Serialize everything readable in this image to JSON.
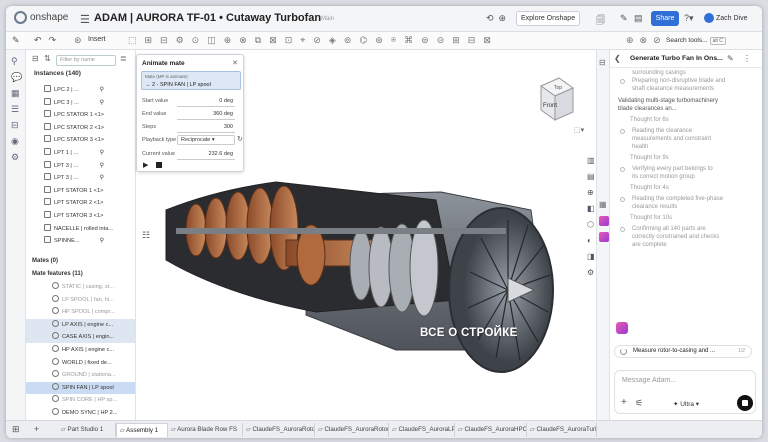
{
  "app": {
    "name": "onshape"
  },
  "document": {
    "title": "ADAM | AURORA TF-01 • Cutaway Turbofan",
    "branch": "Main"
  },
  "header": {
    "explore": "Explore Onshape",
    "share": "Share",
    "user": "Zach Dive"
  },
  "toolbar": {
    "insert": "Insert",
    "search": "Search tools...",
    "search_shortcut": "alt C"
  },
  "tree": {
    "filter_placeholder": "Filter by name",
    "instances_title": "Instances (140)",
    "instances": [
      {
        "label": "LPC 2 | ...",
        "mate": true
      },
      {
        "label": "LPC 3 | ...",
        "mate": true
      },
      {
        "label": "LPC STATOR 1 <1>"
      },
      {
        "label": "LPC STATOR 2 <1>"
      },
      {
        "label": "LPC STATOR 3 <1>"
      },
      {
        "label": "LPT 1 | ...",
        "mate": true
      },
      {
        "label": "LPT 3 | ...",
        "mate": true
      },
      {
        "label": "LPT 3 | ...",
        "mate": true
      },
      {
        "label": "LPT STATOR 1 <1>"
      },
      {
        "label": "LPT STATOR 2 <1>"
      },
      {
        "label": "LPT STATOR 3 <1>"
      },
      {
        "label": "NACELLE | rolled inta..."
      },
      {
        "label": "SPINNE...",
        "mate": true
      }
    ],
    "mates_title": "Mates (0)",
    "features_title": "Mate features (11)",
    "features": [
      {
        "label": "STATIC | casing, st...",
        "state": "grey"
      },
      {
        "label": "LP SPOOL | fan, hi...",
        "state": "grey"
      },
      {
        "label": "HP SPOOL | compr...",
        "state": "grey"
      },
      {
        "label": "LP AXIS | engine c...",
        "state": "sel"
      },
      {
        "label": "CASE AXIS | engin...",
        "state": "sel"
      },
      {
        "label": "HP AXIS | engine c...",
        "state": ""
      },
      {
        "label": "WORLD | fixed de...",
        "state": ""
      },
      {
        "label": "GROUND | stationa...",
        "state": "grey"
      },
      {
        "label": "SPIN FAN | LP spool",
        "state": "hl"
      },
      {
        "label": "SPIN CORE | HP sp...",
        "state": "grey"
      },
      {
        "label": "DEMO SYNC | HP 2...",
        "state": ""
      }
    ]
  },
  "animate": {
    "title": "Animate mate",
    "mate_label": "Mate (MP is animate)",
    "mate_value": "→ 2 - SPIN FAN | LP spool",
    "start_label": "Start value",
    "start_value": "0 deg",
    "end_label": "End value",
    "end_value": "360 deg",
    "steps_label": "Steps",
    "steps_value": "300",
    "playback_label": "Playback type",
    "playback_value": "Reciprocate",
    "current_label": "Current value",
    "current_value": "232.6 deg"
  },
  "viewcube": {
    "front": "Front",
    "top": "Top"
  },
  "watermark": "ВСЕ О СТРОЙКЕ",
  "chat": {
    "title": "Generate Turbo Fan In Ons...",
    "lines": [
      {
        "text": "surrounding casings",
        "tone": "grey"
      },
      {
        "text": "Preparing non-disruptive blade and",
        "tone": "grey",
        "bullet": true
      },
      {
        "text": "shaft clearance measurements",
        "tone": "grey"
      },
      {
        "text": "Validating multi-stage turbomachinery",
        "tone": "dark"
      },
      {
        "text": "blade clearances an...",
        "tone": "dark"
      },
      {
        "text": "Thought for 6s",
        "tone": "grey"
      },
      {
        "text": "Reading the clearance",
        "tone": "grey",
        "bullet": true
      },
      {
        "text": "measurements and constraint",
        "tone": "grey"
      },
      {
        "text": "health",
        "tone": "grey"
      },
      {
        "text": "Thought for 9s",
        "tone": "grey"
      },
      {
        "text": "Verifying every part belongs to",
        "tone": "grey",
        "bullet": true
      },
      {
        "text": "its correct motion group",
        "tone": "grey"
      },
      {
        "text": "Thought for 4s",
        "tone": "grey"
      },
      {
        "text": "Reading the completed five-phase",
        "tone": "grey",
        "bullet": true
      },
      {
        "text": "clearance results",
        "tone": "grey"
      },
      {
        "text": "Thought for 10s",
        "tone": "grey"
      },
      {
        "text": "Confirming all 140 parts are",
        "tone": "grey",
        "bullet": true
      },
      {
        "text": "correctly constrained and checks",
        "tone": "grey"
      },
      {
        "text": "are complete",
        "tone": "grey"
      }
    ],
    "status": "Measure rotor-to-casing and ...",
    "status_meta": "1/2",
    "compose_placeholder": "Message Adam...",
    "model": "Ultra"
  },
  "tabs": [
    "Part Studio 1",
    "Assembly 1",
    "Aurora Blade Row FS",
    "ClaudeFS_AuroraRotor...",
    "ClaudeFS_AuroraRotor...",
    "ClaudeFS_AuroraLPC",
    "ClaudeFS_AuroraHPC",
    "ClaudeFS_AuroraTurbi..."
  ],
  "colors": {
    "accent": "#2f6fd6",
    "selection": "#dde6f1",
    "ai": "#c0449f"
  }
}
